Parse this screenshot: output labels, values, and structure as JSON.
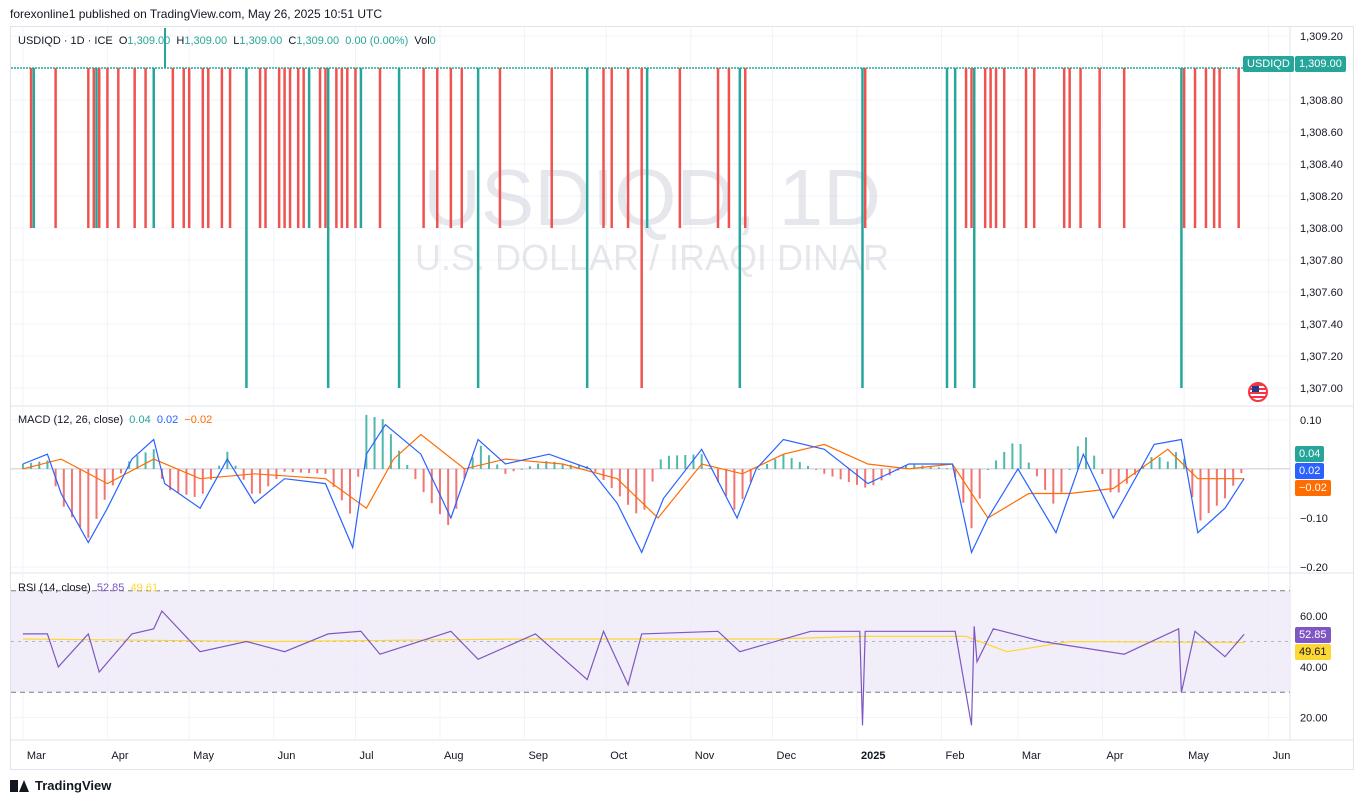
{
  "header": {
    "publish_line": "forexonline1 published on TradingView.com, May 26, 2025 10:51 UTC"
  },
  "price_legend": {
    "symbol_line": "USDIQD · 1D · ICE",
    "o_label": "O",
    "o_value": "1,309.00",
    "h_label": "H",
    "h_value": "1,309.00",
    "l_label": "L",
    "l_value": "1,309.00",
    "c_label": "C",
    "c_value": "1,309.00",
    "change": "0.00 (0.00%)",
    "vol_label": "Vol",
    "vol_value": "0"
  },
  "watermark": {
    "symbol": "USDIQD, 1D",
    "name": "U.S. DOLLAR / IRAQI DINAR"
  },
  "price_tag": {
    "symbol": "USDIQD",
    "value": "1,309.00"
  },
  "macd_legend": {
    "label": "MACD (12, 26, close)",
    "hist": "0.04",
    "macd": "0.02",
    "signal": "−0.02"
  },
  "macd_tags": {
    "hist": "0.04",
    "macd": "0.02",
    "signal": "−0.02"
  },
  "rsi_legend": {
    "label": "RSI (14, close)",
    "rsi": "52.85",
    "ma": "49.61"
  },
  "rsi_tags": {
    "rsi": "52.85",
    "ma": "49.61"
  },
  "branding": {
    "logo_text": "TradingView"
  },
  "colors": {
    "up": "#26a69a",
    "down": "#ef5350",
    "macd_line": "#2962ff",
    "signal_line": "#ff6d00",
    "rsi_line": "#7e57c2",
    "rsi_ma": "#fdd835",
    "rsi_band": "#ede7f6",
    "grid": "#f0f3fa",
    "text": "#131722"
  },
  "chart_data": [
    {
      "type": "bar",
      "name": "price",
      "ylim": [
        1306.9,
        1309.25
      ],
      "y_ticks": [
        "1,309.20",
        "1,308.80",
        "1,308.60",
        "1,308.40",
        "1,308.20",
        "1,308.00",
        "1,307.80",
        "1,307.60",
        "1,307.40",
        "1,307.20",
        "1,307.00"
      ],
      "y_tick_values": [
        1309.2,
        1308.8,
        1308.6,
        1308.4,
        1308.2,
        1308.0,
        1307.8,
        1307.6,
        1307.4,
        1307.2,
        1307.0
      ],
      "x_ticks": [
        "Mar",
        "Apr",
        "May",
        "Jun",
        "Jul",
        "Aug",
        "Sep",
        "Oct",
        "Nov",
        "Dec",
        "2025",
        "Feb",
        "Mar",
        "Apr",
        "May",
        "Jun"
      ],
      "baseline": 1309.0,
      "bars": [
        {
          "d": "2024-03-04",
          "low": 1308.0,
          "dir": "down"
        },
        {
          "d": "2024-03-05",
          "low": 1308.0,
          "dir": "up"
        },
        {
          "d": "2024-03-13",
          "low": 1308.0,
          "dir": "down"
        },
        {
          "d": "2024-03-25",
          "low": 1308.0,
          "dir": "down"
        },
        {
          "d": "2024-03-27",
          "low": 1308.0,
          "dir": "down"
        },
        {
          "d": "2024-03-28",
          "low": 1308.0,
          "dir": "up"
        },
        {
          "d": "2024-03-29",
          "low": 1308.0,
          "dir": "down"
        },
        {
          "d": "2024-04-01",
          "low": 1308.0,
          "dir": "down"
        },
        {
          "d": "2024-04-05",
          "low": 1308.0,
          "dir": "down"
        },
        {
          "d": "2024-04-11",
          "low": 1308.0,
          "dir": "down"
        },
        {
          "d": "2024-04-15",
          "low": 1308.0,
          "dir": "down"
        },
        {
          "d": "2024-04-18",
          "low": 1308.0,
          "dir": "up"
        },
        {
          "d": "2024-04-25",
          "low": 1308.0,
          "dir": "down"
        },
        {
          "d": "2024-04-29",
          "low": 1308.0,
          "dir": "down"
        },
        {
          "d": "2024-05-01",
          "low": 1308.0,
          "dir": "down"
        },
        {
          "d": "2024-05-06",
          "low": 1308.0,
          "dir": "down"
        },
        {
          "d": "2024-05-08",
          "low": 1308.0,
          "dir": "down"
        },
        {
          "d": "2024-05-13",
          "low": 1308.0,
          "dir": "down"
        },
        {
          "d": "2024-05-16",
          "low": 1308.0,
          "dir": "down"
        },
        {
          "d": "2024-05-22",
          "low": 1307.0,
          "dir": "up"
        },
        {
          "d": "2024-05-27",
          "low": 1308.0,
          "dir": "down"
        },
        {
          "d": "2024-05-29",
          "low": 1308.0,
          "dir": "down"
        },
        {
          "d": "2024-06-03",
          "low": 1308.0,
          "dir": "down"
        },
        {
          "d": "2024-06-05",
          "low": 1308.0,
          "dir": "down"
        },
        {
          "d": "2024-06-07",
          "low": 1308.0,
          "dir": "down"
        },
        {
          "d": "2024-06-10",
          "low": 1308.0,
          "dir": "down"
        },
        {
          "d": "2024-06-12",
          "low": 1308.0,
          "dir": "down"
        },
        {
          "d": "2024-06-14",
          "low": 1308.0,
          "dir": "up"
        },
        {
          "d": "2024-06-18",
          "low": 1308.0,
          "dir": "down"
        },
        {
          "d": "2024-06-20",
          "low": 1308.0,
          "dir": "down"
        },
        {
          "d": "2024-06-21",
          "low": 1307.0,
          "dir": "up"
        },
        {
          "d": "2024-06-24",
          "low": 1308.0,
          "dir": "down"
        },
        {
          "d": "2024-06-26",
          "low": 1308.0,
          "dir": "down"
        },
        {
          "d": "2024-06-28",
          "low": 1308.0,
          "dir": "down"
        },
        {
          "d": "2024-07-01",
          "low": 1308.0,
          "dir": "down"
        },
        {
          "d": "2024-07-03",
          "low": 1308.0,
          "dir": "up"
        },
        {
          "d": "2024-07-10",
          "low": 1308.0,
          "dir": "down"
        },
        {
          "d": "2024-07-17",
          "low": 1307.0,
          "dir": "up"
        },
        {
          "d": "2024-07-26",
          "low": 1308.0,
          "dir": "down"
        },
        {
          "d": "2024-07-31",
          "low": 1308.0,
          "dir": "down"
        },
        {
          "d": "2024-08-05",
          "low": 1308.0,
          "dir": "down"
        },
        {
          "d": "2024-08-09",
          "low": 1308.0,
          "dir": "down"
        },
        {
          "d": "2024-08-15",
          "low": 1307.0,
          "dir": "up"
        },
        {
          "d": "2024-08-23",
          "low": 1308.0,
          "dir": "down"
        },
        {
          "d": "2024-09-11",
          "low": 1308.0,
          "dir": "down"
        },
        {
          "d": "2024-09-24",
          "low": 1307.0,
          "dir": "up"
        },
        {
          "d": "2024-09-30",
          "low": 1308.0,
          "dir": "down"
        },
        {
          "d": "2024-10-03",
          "low": 1308.0,
          "dir": "down"
        },
        {
          "d": "2024-10-09",
          "low": 1308.0,
          "dir": "down"
        },
        {
          "d": "2024-10-14",
          "low": 1307.0,
          "dir": "down"
        },
        {
          "d": "2024-10-16",
          "low": 1308.0,
          "dir": "up"
        },
        {
          "d": "2024-10-28",
          "low": 1308.0,
          "dir": "down"
        },
        {
          "d": "2024-11-11",
          "low": 1308.0,
          "dir": "down"
        },
        {
          "d": "2024-11-15",
          "low": 1308.0,
          "dir": "down"
        },
        {
          "d": "2024-11-19",
          "low": 1307.0,
          "dir": "up"
        },
        {
          "d": "2024-11-21",
          "low": 1308.0,
          "dir": "down"
        },
        {
          "d": "2025-01-03",
          "low": 1307.0,
          "dir": "up"
        },
        {
          "d": "2025-01-04",
          "low": 1308.0,
          "dir": "down"
        },
        {
          "d": "2025-02-03",
          "low": 1307.0,
          "dir": "up"
        },
        {
          "d": "2025-02-06",
          "low": 1307.0,
          "dir": "up"
        },
        {
          "d": "2025-02-10",
          "low": 1308.0,
          "dir": "down"
        },
        {
          "d": "2025-02-12",
          "low": 1308.0,
          "dir": "down"
        },
        {
          "d": "2025-02-13",
          "low": 1307.0,
          "dir": "up"
        },
        {
          "d": "2025-02-17",
          "low": 1308.0,
          "dir": "down"
        },
        {
          "d": "2025-02-19",
          "low": 1308.0,
          "dir": "down"
        },
        {
          "d": "2025-02-21",
          "low": 1308.0,
          "dir": "down"
        },
        {
          "d": "2025-02-24",
          "low": 1308.0,
          "dir": "down"
        },
        {
          "d": "2025-03-04",
          "low": 1308.0,
          "dir": "down"
        },
        {
          "d": "2025-03-07",
          "low": 1308.0,
          "dir": "down"
        },
        {
          "d": "2025-03-18",
          "low": 1308.0,
          "dir": "down"
        },
        {
          "d": "2025-03-20",
          "low": 1308.0,
          "dir": "down"
        },
        {
          "d": "2025-03-24",
          "low": 1308.0,
          "dir": "down"
        },
        {
          "d": "2025-03-31",
          "low": 1308.0,
          "dir": "down"
        },
        {
          "d": "2025-04-09",
          "low": 1308.0,
          "dir": "down"
        },
        {
          "d": "2025-04-30",
          "low": 1307.0,
          "dir": "up"
        },
        {
          "d": "2025-05-01",
          "low": 1308.0,
          "dir": "down"
        },
        {
          "d": "2025-05-05",
          "low": 1308.0,
          "dir": "down"
        },
        {
          "d": "2025-05-09",
          "low": 1308.0,
          "dir": "down"
        },
        {
          "d": "2025-05-12",
          "low": 1308.0,
          "dir": "down"
        },
        {
          "d": "2025-05-14",
          "low": 1308.0,
          "dir": "down"
        },
        {
          "d": "2025-05-21",
          "low": 1308.0,
          "dir": "down"
        }
      ]
    },
    {
      "type": "line",
      "name": "MACD (12, 26, close)",
      "ylim": [
        -0.21,
        0.12
      ],
      "y_ticks": [
        "0.10",
        "−0.10",
        "−0.20"
      ],
      "y_tick_values": [
        0.1,
        -0.1,
        -0.2
      ],
      "series": [
        {
          "name": "MACD",
          "color": "#2962ff",
          "x": [
            "2024-03-01",
            "2024-03-10",
            "2024-03-15",
            "2024-03-25",
            "2024-04-01",
            "2024-04-10",
            "2024-04-18",
            "2024-04-22",
            "2024-05-05",
            "2024-05-15",
            "2024-05-25",
            "2024-06-05",
            "2024-06-20",
            "2024-06-30",
            "2024-07-05",
            "2024-07-12",
            "2024-07-25",
            "2024-08-05",
            "2024-08-15",
            "2024-08-25",
            "2024-09-10",
            "2024-09-25",
            "2024-10-05",
            "2024-10-14",
            "2024-10-22",
            "2024-11-05",
            "2024-11-18",
            "2024-11-25",
            "2024-12-05",
            "2024-12-20",
            "2025-01-05",
            "2025-01-20",
            "2025-02-05",
            "2025-02-12",
            "2025-02-18",
            "2025-03-01",
            "2025-03-15",
            "2025-03-25",
            "2025-04-05",
            "2025-04-20",
            "2025-04-30",
            "2025-05-06",
            "2025-05-16",
            "2025-05-23"
          ],
          "y": [
            0.01,
            0.03,
            -0.05,
            -0.15,
            -0.08,
            0.02,
            0.06,
            -0.03,
            -0.08,
            0.02,
            -0.07,
            -0.02,
            -0.03,
            -0.16,
            0.03,
            0.09,
            0.03,
            -0.1,
            0.06,
            0.01,
            0.03,
            0.0,
            -0.07,
            -0.17,
            -0.06,
            0.04,
            -0.1,
            0.0,
            0.06,
            0.04,
            -0.03,
            0.01,
            0.01,
            -0.17,
            -0.1,
            0.0,
            -0.13,
            0.03,
            -0.1,
            0.05,
            0.06,
            -0.13,
            -0.08,
            -0.02
          ]
        },
        {
          "name": "Signal",
          "color": "#ff6d00",
          "x": [
            "2024-03-01",
            "2024-03-15",
            "2024-04-01",
            "2024-04-18",
            "2024-05-05",
            "2024-05-25",
            "2024-06-20",
            "2024-07-05",
            "2024-07-15",
            "2024-07-25",
            "2024-08-10",
            "2024-08-25",
            "2024-09-15",
            "2024-10-05",
            "2024-10-20",
            "2024-11-05",
            "2024-11-20",
            "2024-12-05",
            "2024-12-20",
            "2025-01-05",
            "2025-01-20",
            "2025-02-05",
            "2025-02-18",
            "2025-03-05",
            "2025-03-20",
            "2025-04-05",
            "2025-04-25",
            "2025-05-06",
            "2025-05-23"
          ],
          "y": [
            0.0,
            0.02,
            -0.03,
            0.02,
            -0.02,
            -0.01,
            -0.02,
            -0.08,
            0.02,
            0.07,
            0.0,
            0.02,
            0.01,
            -0.02,
            -0.1,
            0.01,
            -0.01,
            0.03,
            0.05,
            0.01,
            0.0,
            0.01,
            -0.1,
            -0.05,
            -0.05,
            -0.04,
            0.04,
            -0.02,
            -0.02
          ]
        },
        {
          "name": "Histogram",
          "color": "#26a69a",
          "values_desc": "sign follows MACD − Signal"
        }
      ],
      "last": {
        "histogram": 0.04,
        "macd": 0.02,
        "signal": -0.02
      }
    },
    {
      "type": "line",
      "name": "RSI (14, close)",
      "ylim": [
        12,
        75
      ],
      "y_ticks": [
        "60.00",
        "40.00",
        "20.00"
      ],
      "y_tick_values": [
        60,
        40,
        20
      ],
      "bands": {
        "upper": 70,
        "middle": 50,
        "lower": 30
      },
      "series": [
        {
          "name": "RSI",
          "color": "#7e57c2",
          "x": [
            "2024-03-01",
            "2024-03-10",
            "2024-03-14",
            "2024-03-25",
            "2024-03-29",
            "2024-04-10",
            "2024-04-18",
            "2024-04-21",
            "2024-05-05",
            "2024-05-22",
            "2024-06-05",
            "2024-06-21",
            "2024-07-03",
            "2024-07-10",
            "2024-08-05",
            "2024-08-15",
            "2024-09-05",
            "2024-09-24",
            "2024-09-30",
            "2024-10-09",
            "2024-10-14",
            "2024-11-11",
            "2024-11-19",
            "2024-12-15",
            "2025-01-02",
            "2025-01-03",
            "2025-01-04",
            "2025-02-06",
            "2025-02-12",
            "2025-02-13",
            "2025-02-14",
            "2025-02-20",
            "2025-03-10",
            "2025-04-09",
            "2025-04-29",
            "2025-04-30",
            "2025-05-05",
            "2025-05-16",
            "2025-05-23"
          ],
          "y": [
            53,
            53,
            40,
            53,
            38,
            53,
            55,
            62,
            46,
            50,
            46,
            53,
            54,
            45,
            54,
            43,
            53,
            35,
            54,
            33,
            53,
            54,
            46,
            54,
            54,
            17,
            54,
            54,
            17,
            56,
            42,
            55,
            50,
            45,
            55,
            30,
            54,
            44,
            52.85
          ]
        },
        {
          "name": "RSI-based MA",
          "color": "#fdd835",
          "x": [
            "2024-03-01",
            "2024-06-01",
            "2024-09-01",
            "2024-12-01",
            "2025-01-03",
            "2025-02-10",
            "2025-02-25",
            "2025-03-20",
            "2025-05-23"
          ],
          "y": [
            51,
            50,
            51,
            51,
            52,
            52,
            46,
            50,
            49.61
          ]
        }
      ],
      "last": {
        "rsi": 52.85,
        "ma": 49.61
      }
    }
  ]
}
